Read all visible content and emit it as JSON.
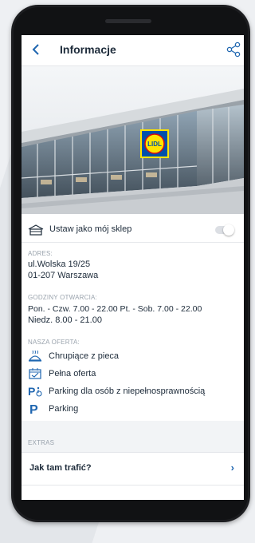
{
  "header": {
    "title": "Informacje"
  },
  "store_row": {
    "label": "Ustaw jako mój sklep"
  },
  "address": {
    "label": "ADRES:",
    "line1": "ul.Wolska 19/25",
    "line2": "01-207 Warszawa"
  },
  "hours": {
    "label": "GODZINY OTWARCIA:",
    "line1": "Pon. - Czw. 7.00 - 22.00 Pt. - Sob. 7.00 - 22.00",
    "line2": "Niedz. 8.00 - 21.00"
  },
  "offer": {
    "label": "NASZA OFERTA:",
    "items": [
      {
        "label": "Chrupiące z pieca",
        "icon": "bread-oven-icon"
      },
      {
        "label": "Pełna oferta",
        "icon": "full-offer-icon"
      },
      {
        "label": "Parking dla osób z niepełnosprawnością",
        "icon": "disabled-parking-icon"
      },
      {
        "label": "Parking",
        "icon": "parking-icon"
      }
    ]
  },
  "extras": {
    "label": "EXTRAS",
    "route_label": "Jak tam trafić?"
  },
  "hero": {
    "logo_text": "LIDL"
  },
  "colors": {
    "accent": "#1f66b0",
    "text": "#1d2b3a",
    "muted": "#9aa3ad"
  }
}
